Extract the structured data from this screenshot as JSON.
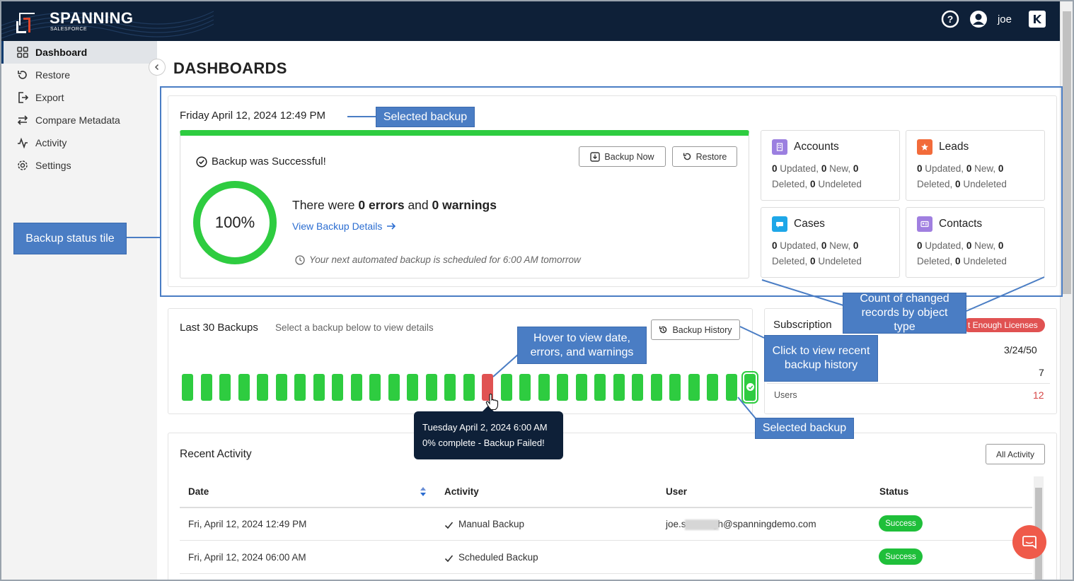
{
  "brand": {
    "name": "SPANNING",
    "sub": "SALESFORCE"
  },
  "header": {
    "user": "joe",
    "help_icon": "question-circle-icon",
    "user_icon": "user-circle-icon",
    "app_icon": "k-icon"
  },
  "sidebar": {
    "items": [
      {
        "label": "Dashboard",
        "icon": "grid-icon",
        "active": true
      },
      {
        "label": "Restore",
        "icon": "restore-icon"
      },
      {
        "label": "Export",
        "icon": "export-icon"
      },
      {
        "label": "Compare Metadata",
        "icon": "compare-icon"
      },
      {
        "label": "Activity",
        "icon": "activity-icon"
      },
      {
        "label": "Settings",
        "icon": "gear-icon"
      }
    ]
  },
  "page": {
    "title": "DASHBOARDS"
  },
  "backup": {
    "date": "Friday April 12, 2024 12:49 PM",
    "status": "Backup was Successful!",
    "backup_now": "Backup Now",
    "restore": "Restore",
    "percent": "100%",
    "percent_value": 100,
    "errors_prefix": "There were",
    "errors": "0 errors",
    "and": "and",
    "warnings": "0 warnings",
    "view_details": "View Backup Details",
    "next": "Your next automated backup is scheduled for 6:00 AM tomorrow"
  },
  "objects": [
    {
      "name": "Accounts",
      "color": "#9b7fe0",
      "updated": "0",
      "new": "0",
      "deleted": "0",
      "undeleted": "0"
    },
    {
      "name": "Leads",
      "color": "#f26b3a",
      "updated": "0",
      "new": "0",
      "deleted": "0",
      "undeleted": "0"
    },
    {
      "name": "Cases",
      "color": "#1ea7e8",
      "updated": "0",
      "new": "0",
      "deleted": "0",
      "undeleted": "0"
    },
    {
      "name": "Contacts",
      "color": "#a07fe0",
      "updated": "0",
      "new": "0",
      "deleted": "0",
      "undeleted": "0"
    }
  ],
  "last30": {
    "title": "Last 30 Backups",
    "subtitle": "Select a backup below to view details",
    "history_button": "Backup History",
    "statuses": [
      "success",
      "success",
      "success",
      "success",
      "success",
      "success",
      "success",
      "success",
      "success",
      "success",
      "success",
      "success",
      "success",
      "success",
      "success",
      "success",
      "fail",
      "success",
      "success",
      "success",
      "success",
      "success",
      "success",
      "success",
      "success",
      "success",
      "success",
      "success",
      "success",
      "success",
      "selected"
    ],
    "tooltip_line1": "Tuesday April 2, 2024 6:00 AM",
    "tooltip_line2": "0% complete - Backup Failed!"
  },
  "subscription": {
    "title": "Subscription",
    "badge": "t Enough Licenses",
    "value1": "3/24/50",
    "value2": "7",
    "users_label": "Users",
    "users_value": "12"
  },
  "recent": {
    "title": "Recent Activity",
    "all_button": "All Activity",
    "columns": [
      "Date",
      "Activity",
      "User",
      "Status"
    ],
    "rows": [
      {
        "date": "Fri, April 12, 2024 12:49 PM",
        "activity": "Manual Backup",
        "user": "joe.s          gh@spanningdemo.com",
        "status": "Success"
      },
      {
        "date": "Fri, April 12, 2024 06:00 AM",
        "activity": "Scheduled Backup",
        "user": "",
        "status": "Success"
      }
    ]
  },
  "callouts": {
    "selected_backup_top": "Selected backup",
    "status_tile": "Backup status tile",
    "count_changed": "Count of changed records by object type",
    "hover": "Hover to view date, errors, and warnings",
    "click_history": "Click to view recent backup history",
    "selected_backup_bottom": "Selected backup"
  }
}
